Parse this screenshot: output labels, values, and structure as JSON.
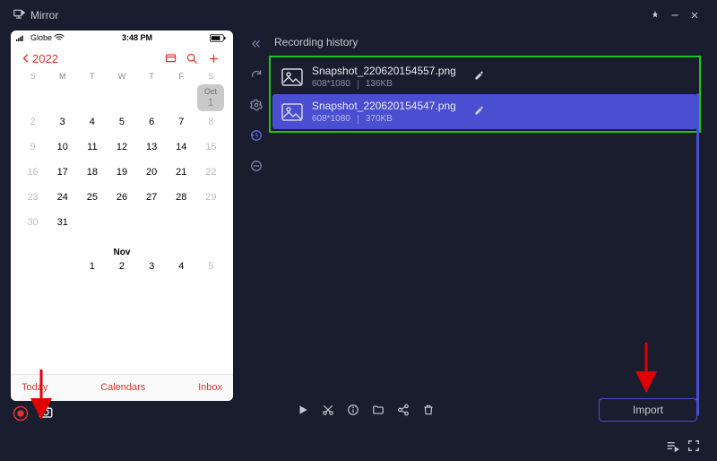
{
  "titlebar": {
    "app_name": "Mirror"
  },
  "phone": {
    "carrier": "Globe",
    "time": "3:48 PM",
    "year_label": "2022",
    "oct_label": "Oct",
    "oct_day": "1",
    "nov_label": "Nov",
    "dow": [
      "S",
      "M",
      "T",
      "W",
      "T",
      "F",
      "S"
    ],
    "week1": [
      "2",
      "3",
      "4",
      "5",
      "6",
      "7",
      "8"
    ],
    "week2": [
      "9",
      "10",
      "11",
      "12",
      "13",
      "14",
      "15"
    ],
    "week3": [
      "16",
      "17",
      "18",
      "19",
      "20",
      "21",
      "22"
    ],
    "week4": [
      "23",
      "24",
      "25",
      "26",
      "27",
      "28",
      "29"
    ],
    "week5": [
      "30",
      "31",
      "",
      "",
      "",
      "",
      ""
    ],
    "nov_row": [
      "",
      "",
      "1",
      "2",
      "3",
      "4",
      "5"
    ],
    "footer": {
      "today": "Today",
      "calendars": "Calendars",
      "inbox": "Inbox"
    }
  },
  "history": {
    "title": "Recording history",
    "items": [
      {
        "name": "Snapshot_220620154557.png",
        "res": "608*1080",
        "size": "136KB"
      },
      {
        "name": "Snapshot_220620154547.png",
        "res": "608*1080",
        "size": "370KB"
      }
    ],
    "import_label": "Import"
  }
}
